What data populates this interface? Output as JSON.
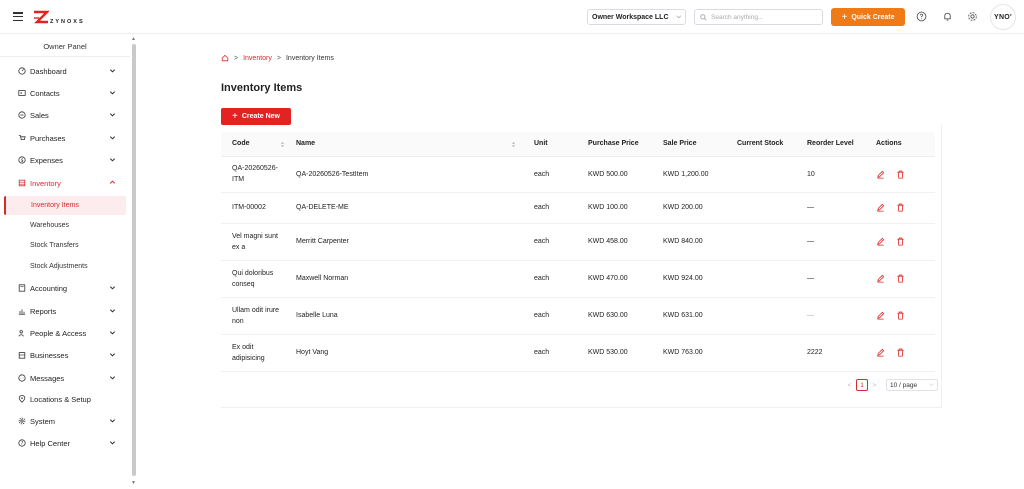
{
  "header": {
    "logo_text": "ZYNOXS",
    "workspace": "Owner Workspace LLC",
    "search_placeholder": "Search anything...",
    "quick_create": "Quick Create",
    "avatar_text": "YNO'",
    "accent_color": "#f07a16"
  },
  "sidebar": {
    "panel_title": "Owner Panel",
    "items": [
      {
        "label": "Dashboard",
        "icon": "gauge-icon"
      },
      {
        "label": "Contacts",
        "icon": "contact-card-icon"
      },
      {
        "label": "Sales",
        "icon": "sales-icon"
      },
      {
        "label": "Purchases",
        "icon": "cart-icon"
      },
      {
        "label": "Expenses",
        "icon": "dollar-icon"
      },
      {
        "label": "Inventory",
        "icon": "inventory-icon",
        "open": true
      },
      {
        "label": "Accounting",
        "icon": "calculator-icon"
      },
      {
        "label": "Reports",
        "icon": "chart-icon"
      },
      {
        "label": "People & Access",
        "icon": "people-icon"
      },
      {
        "label": "Businesses",
        "icon": "building-icon"
      },
      {
        "label": "Messages",
        "icon": "chat-icon"
      },
      {
        "label": "Locations & Setup",
        "icon": "location-icon"
      },
      {
        "label": "System",
        "icon": "gear-icon"
      },
      {
        "label": "Help Center",
        "icon": "help-icon"
      }
    ],
    "inventory_sub": [
      {
        "label": "Inventory Items",
        "active": true
      },
      {
        "label": "Warehouses"
      },
      {
        "label": "Stock Transfers"
      },
      {
        "label": "Stock Adjustments"
      }
    ],
    "active_color": "#d62b2b"
  },
  "breadcrumb": {
    "sep": ">",
    "parent": "Inventory",
    "current": "Inventory Items"
  },
  "page": {
    "title": "Inventory Items",
    "create_label": "Create New"
  },
  "table": {
    "columns": [
      "Code",
      "Name",
      "Unit",
      "Purchase Price",
      "Sale Price",
      "Current Stock",
      "Reorder Level",
      "Actions"
    ],
    "rows": [
      {
        "code": "QA-20260526-ITM",
        "name": "QA-20260526-TestItem",
        "unit": "each",
        "purchase": "KWD 500.00",
        "sale": "KWD 1,200.00",
        "stock": "",
        "reorder": "10"
      },
      {
        "code": "ITM-00002",
        "name": "QA-DELETE-ME",
        "unit": "each",
        "purchase": "KWD 100.00",
        "sale": "KWD 200.00",
        "stock": "",
        "reorder": "—"
      },
      {
        "code": "Vel magni sunt ex a",
        "name": "Merritt Carpenter",
        "unit": "each",
        "purchase": "KWD 458.00",
        "sale": "KWD 840.00",
        "stock": "",
        "reorder": "—"
      },
      {
        "code": "Qui doloribus conseq",
        "name": "Maxwell Norman",
        "unit": "each",
        "purchase": "KWD 470.00",
        "sale": "KWD 924.00",
        "stock": "",
        "reorder": "—"
      },
      {
        "code": "Ullam odit irure non",
        "name": "Isabelle Luna",
        "unit": "each",
        "purchase": "KWD 630.00",
        "sale": "KWD 631.00",
        "stock": "",
        "reorder": "—"
      },
      {
        "code": "Ex odit adipisicing",
        "name": "Hoyt Vang",
        "unit": "each",
        "purchase": "KWD 530.00",
        "sale": "KWD 763.00",
        "stock": "",
        "reorder": "2222"
      }
    ]
  },
  "pagination": {
    "prev": "<",
    "current_page": "1",
    "next": ">",
    "page_size": "10 / page"
  }
}
